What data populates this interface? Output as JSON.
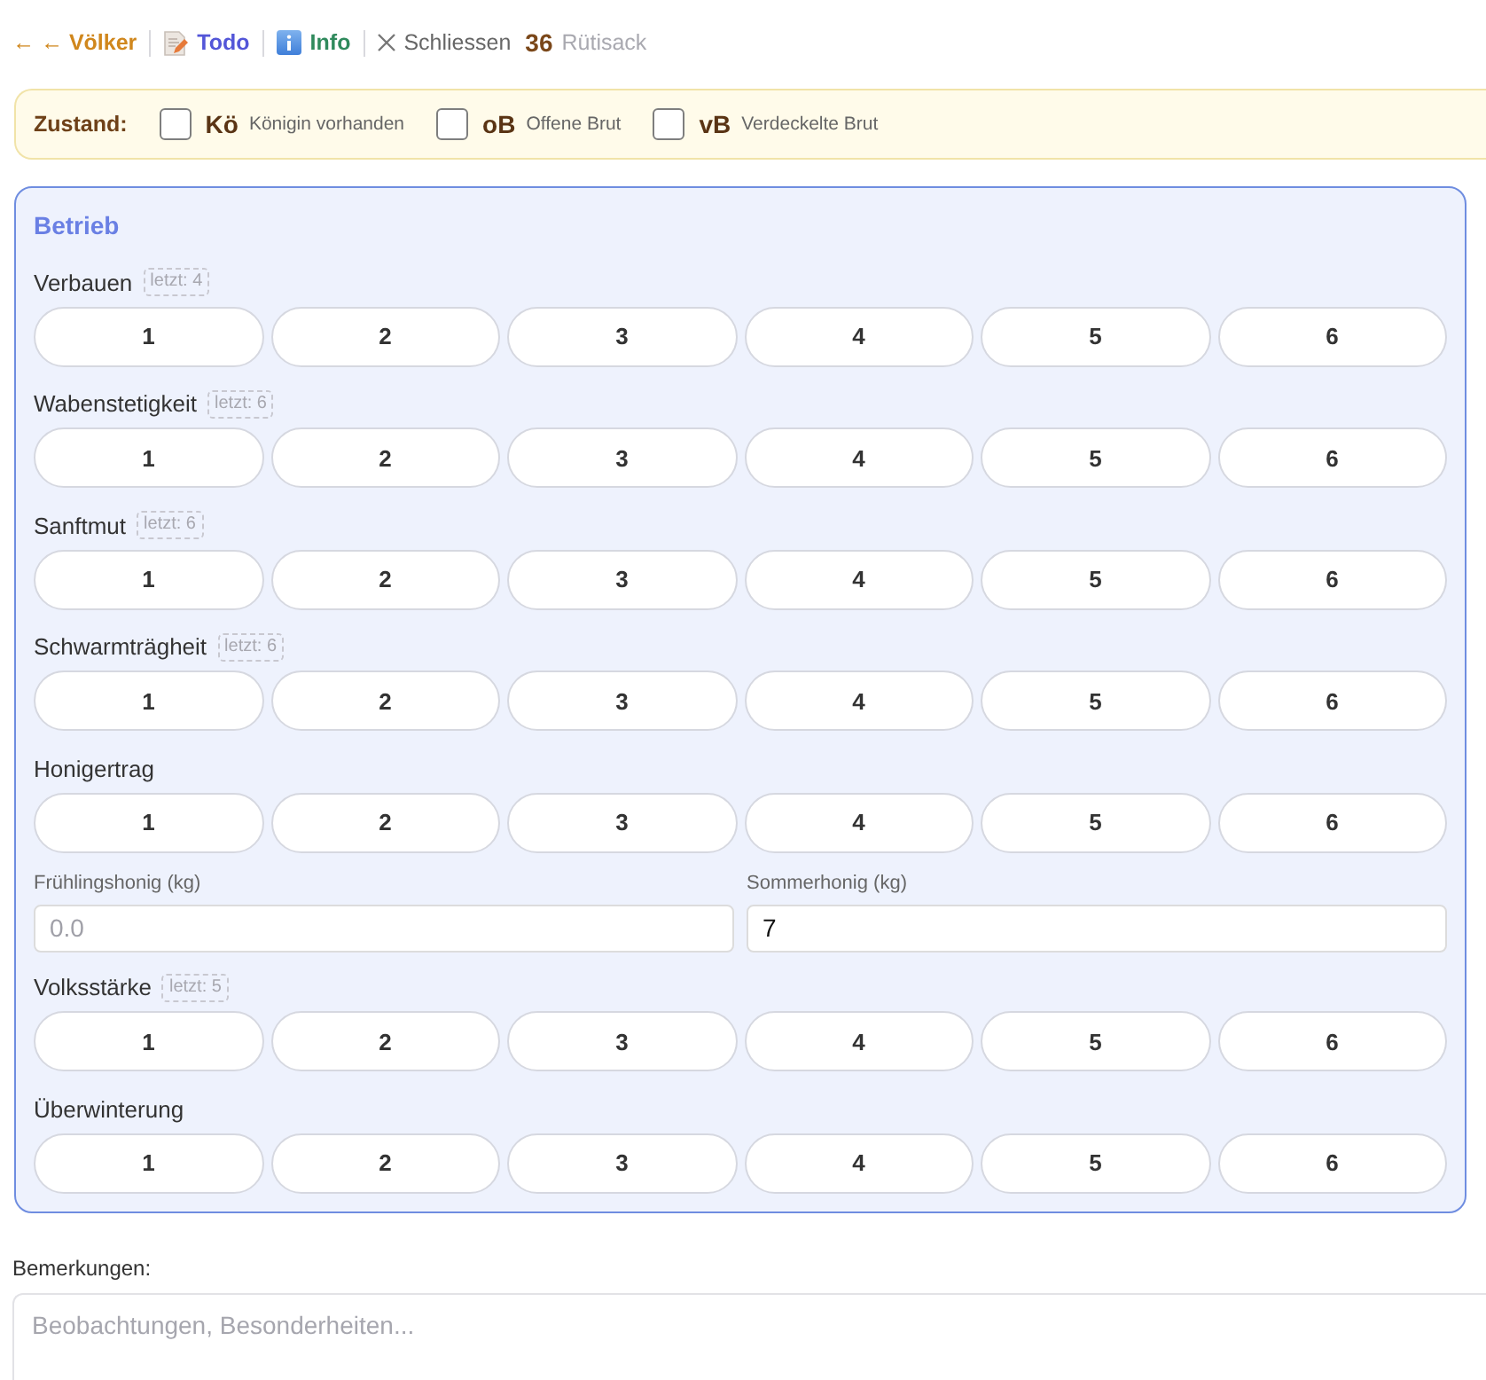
{
  "nav": {
    "links": [
      {
        "kind": "back",
        "label": "← ← Völker"
      },
      {
        "kind": "todo",
        "label": "Todo"
      },
      {
        "kind": "info",
        "label": "Info"
      },
      {
        "kind": "close",
        "label": "Schliessen"
      }
    ],
    "hive_number": "36",
    "hive_name": "Rütisack"
  },
  "status_bar": {
    "label": "Zustand:",
    "items": [
      {
        "code": "Kö",
        "label": "Königin vorhanden",
        "checked": false
      },
      {
        "code": "oB",
        "label": "Offene Brut",
        "checked": false
      },
      {
        "code": "vB",
        "label": "Verdeckelte Brut",
        "checked": false
      }
    ]
  },
  "panel": {
    "title": "Betrieb",
    "sections": [
      {
        "kind": "rating",
        "label": "Verbauen",
        "last": "letzt: 4",
        "options": [
          {
            "label": "1",
            "selected": false
          },
          {
            "label": "2",
            "selected": false
          },
          {
            "label": "3",
            "selected": false
          },
          {
            "label": "4",
            "selected": false
          },
          {
            "label": "5",
            "selected": false
          },
          {
            "label": "6",
            "selected": false
          }
        ]
      },
      {
        "kind": "rating",
        "label": "Wabenstetigkeit",
        "last": "letzt: 6",
        "options": [
          {
            "label": "1",
            "selected": false
          },
          {
            "label": "2",
            "selected": false
          },
          {
            "label": "3",
            "selected": false
          },
          {
            "label": "4",
            "selected": false
          },
          {
            "label": "5",
            "selected": false
          },
          {
            "label": "6",
            "selected": false
          }
        ]
      },
      {
        "kind": "rating",
        "label": "Sanftmut",
        "last": "letzt: 6",
        "options": [
          {
            "label": "1",
            "selected": false
          },
          {
            "label": "2",
            "selected": false
          },
          {
            "label": "3",
            "selected": false
          },
          {
            "label": "4",
            "selected": false
          },
          {
            "label": "5",
            "selected": false
          },
          {
            "label": "6",
            "selected": false
          }
        ]
      },
      {
        "kind": "rating",
        "label": "Schwarmträgheit",
        "last": "letzt: 6",
        "options": [
          {
            "label": "1",
            "selected": false
          },
          {
            "label": "2",
            "selected": false
          },
          {
            "label": "3",
            "selected": false
          },
          {
            "label": "4",
            "selected": false
          },
          {
            "label": "5",
            "selected": false
          },
          {
            "label": "6",
            "selected": false
          }
        ]
      },
      {
        "kind": "rating",
        "label": "Honigertrag",
        "options": [
          {
            "label": "1",
            "selected": false
          },
          {
            "label": "2",
            "selected": false
          },
          {
            "label": "3",
            "selected": false
          },
          {
            "label": "4",
            "selected": false
          },
          {
            "label": "5",
            "selected": false
          },
          {
            "label": "6",
            "selected": false
          }
        ]
      },
      {
        "kind": "inputs",
        "fields": [
          {
            "label": "Frühlingshonig (kg)",
            "placeholder": "0.0"
          },
          {
            "label": "Sommerhonig (kg)",
            "value": "7"
          }
        ]
      },
      {
        "kind": "rating",
        "label": "Volksstärke",
        "last": "letzt: 5",
        "options": [
          {
            "label": "1",
            "selected": false
          },
          {
            "label": "2",
            "selected": false
          },
          {
            "label": "3",
            "selected": false
          },
          {
            "label": "4",
            "selected": false
          },
          {
            "label": "5",
            "selected": false
          },
          {
            "label": "6",
            "selected": false
          }
        ]
      },
      {
        "kind": "rating",
        "label": "Überwinterung",
        "options": [
          {
            "label": "1",
            "selected": false
          },
          {
            "label": "2",
            "selected": false
          },
          {
            "label": "3",
            "selected": false
          },
          {
            "label": "4",
            "selected": false
          },
          {
            "label": "5",
            "selected": false
          },
          {
            "label": "6",
            "selected": false
          }
        ]
      }
    ]
  },
  "remarks": {
    "label": "Bemerkungen:",
    "placeholder": "Beobachtungen, Besonderheiten..."
  }
}
